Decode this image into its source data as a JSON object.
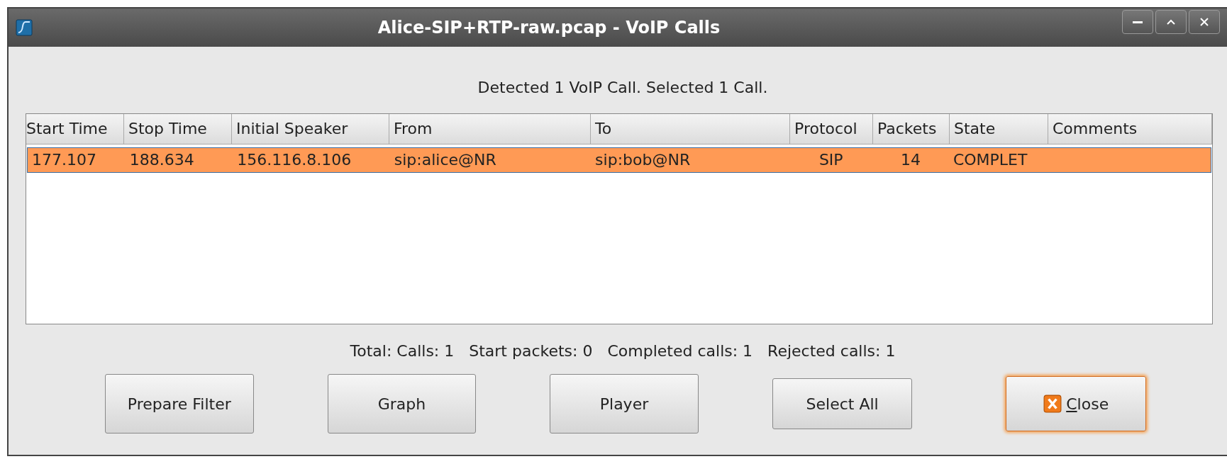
{
  "window": {
    "title": "Alice-SIP+RTP-raw.pcap - VoIP Calls"
  },
  "summary": "Detected 1 VoIP Call. Selected 1 Call.",
  "table": {
    "columns": [
      "Start Time",
      "Stop Time",
      "Initial Speaker",
      "From",
      "To",
      "Protocol",
      "Packets",
      "State",
      "Comments"
    ],
    "rows": [
      {
        "selected": true,
        "cells": [
          "177.107",
          "188.634",
          "156.116.8.106",
          "sip:alice@NR",
          "sip:bob@NR",
          "SIP",
          "14",
          "COMPLET",
          ""
        ]
      }
    ]
  },
  "status_bar": "Total: Calls: 1   Start packets: 0   Completed calls: 1   Rejected calls: 1",
  "buttons": [
    {
      "label": "Prepare Filter",
      "kind": "plain",
      "focused": false
    },
    {
      "label": "Graph",
      "kind": "plain",
      "focused": false
    },
    {
      "label": "Player",
      "kind": "plain",
      "focused": false
    },
    {
      "label": "Select All",
      "kind": "plain",
      "focused": false
    },
    {
      "label": "Close",
      "kind": "close",
      "focused": true
    }
  ]
}
